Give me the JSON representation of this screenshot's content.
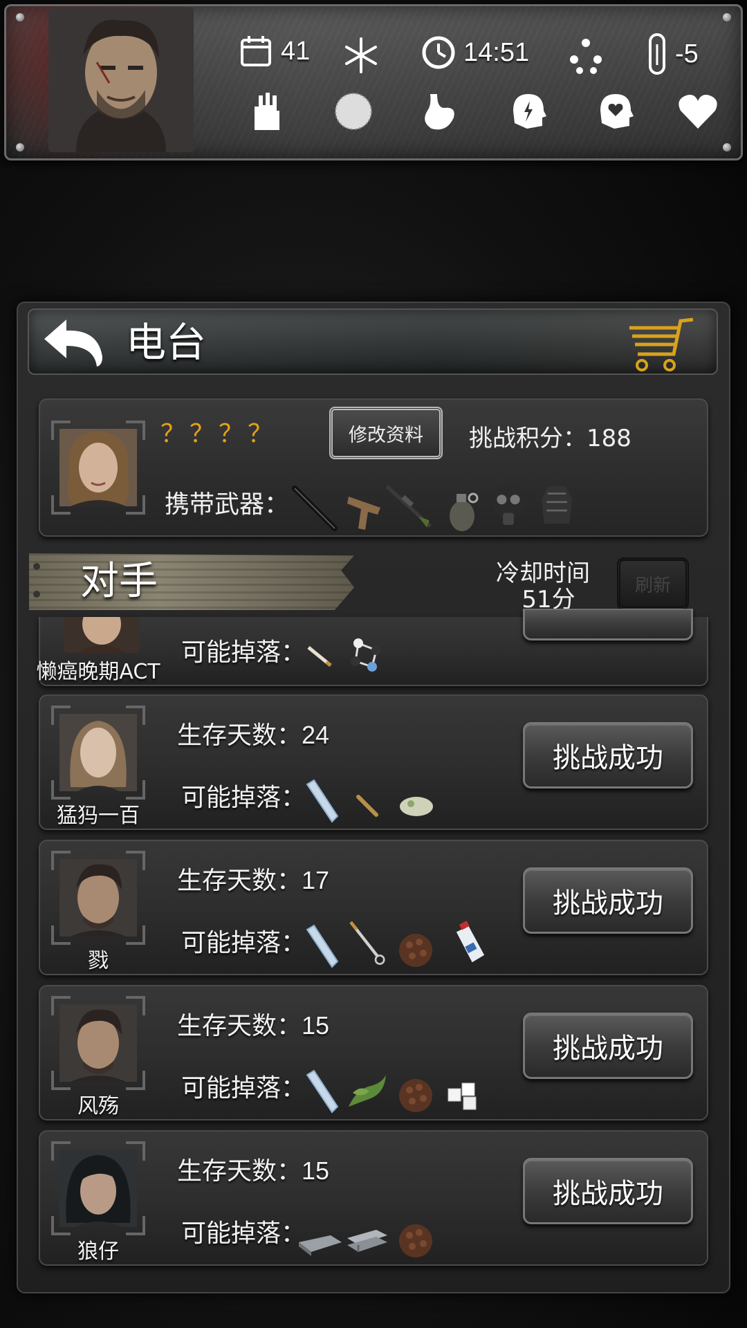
{
  "status": {
    "day": "41",
    "time": "14:51",
    "temperature": "-5"
  },
  "header": {
    "title": "电台"
  },
  "player": {
    "name": "？？？？",
    "edit_label": "修改资料",
    "score_label": "挑战积分：188",
    "weapons_label": "携带武器："
  },
  "opponents": {
    "title": "对手",
    "cooldown_label": "冷却时间",
    "cooldown_value": "51分",
    "refresh_label": "刷新",
    "days_label": "生存天数：",
    "drops_label": "可能掉落：",
    "challenge_label": "挑战成功",
    "list": [
      {
        "name": "懒癌晚期ACT",
        "days": ""
      },
      {
        "name": "猛犸一百",
        "days": "24"
      },
      {
        "name": "戮",
        "days": "17"
      },
      {
        "name": "风殇",
        "days": "15"
      },
      {
        "name": "狼仔",
        "days": "15"
      }
    ]
  },
  "colors": {
    "accent_gold": "#e5a216",
    "panel_bg": "#2c2c2c"
  }
}
